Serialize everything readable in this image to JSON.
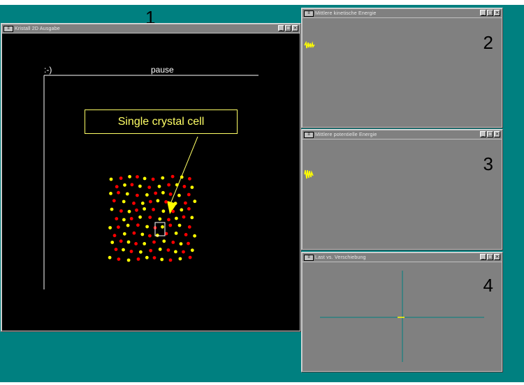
{
  "labels": {
    "num1": "1",
    "num2": "2",
    "num3": "3",
    "num4": "4"
  },
  "windows": {
    "main": {
      "title": "Kristall 2D Ausgabe",
      "status_left": ":-)",
      "status_center": "pause",
      "callout": "Single crystal cell"
    },
    "kinetic": {
      "title": "Mittlere kinetische Energie"
    },
    "potential": {
      "title": "Mittlere potentielle Energie"
    },
    "load": {
      "title": "Last vs. Verschiebung"
    }
  },
  "controls": {
    "minimize": "_",
    "maximize": "□",
    "close": "×"
  },
  "colors": {
    "desktop": "#008080",
    "plot_bg": "#808080",
    "canvas_bg": "#000000",
    "red_atom": "#ff0000",
    "yellow_atom": "#ffff00",
    "axis": "#008080"
  }
}
